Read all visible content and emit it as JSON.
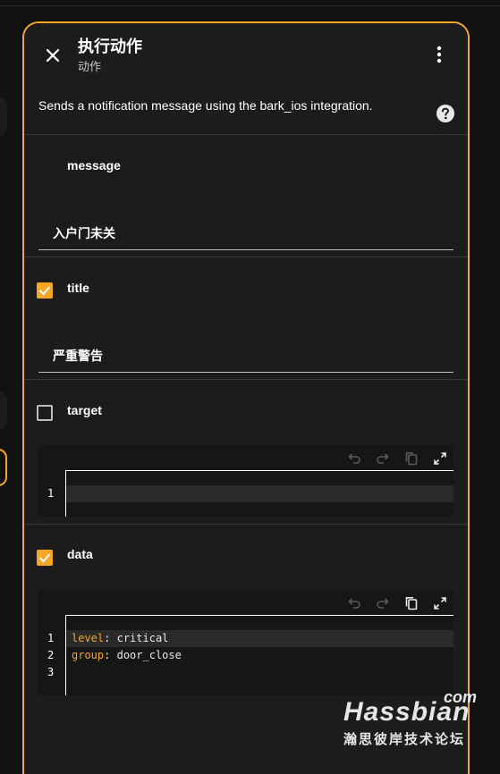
{
  "dialog": {
    "title": "执行动作",
    "subtitle": "动作",
    "description": "Sends a notification message using the bark_ios integration."
  },
  "fields": {
    "message": {
      "label": "message",
      "value": "入户门未关"
    },
    "title": {
      "label": "title",
      "value": "严重警告",
      "checked": true
    },
    "target": {
      "label": "target",
      "checked": false,
      "lines": [
        "1"
      ]
    },
    "data": {
      "label": "data",
      "checked": true,
      "line_numbers": [
        "1",
        "2",
        "3"
      ],
      "code": [
        {
          "key": "level",
          "sep": ":",
          "value": "critical"
        },
        {
          "key": "group",
          "sep": ":",
          "value": "door_close"
        }
      ]
    }
  },
  "icons": {
    "close": "close-icon",
    "menu": "more-vertical-icon",
    "help": "help-circle-icon",
    "undo": "undo-icon",
    "redo": "redo-icon",
    "copy": "copy-icon",
    "fullscreen": "fullscreen-icon"
  },
  "colors": {
    "accent": "#f5a623",
    "background": "#1c1c1c"
  },
  "watermark": {
    "com": "com",
    "brand": "Hassbian",
    "tagline": "瀚思彼岸技术论坛"
  }
}
